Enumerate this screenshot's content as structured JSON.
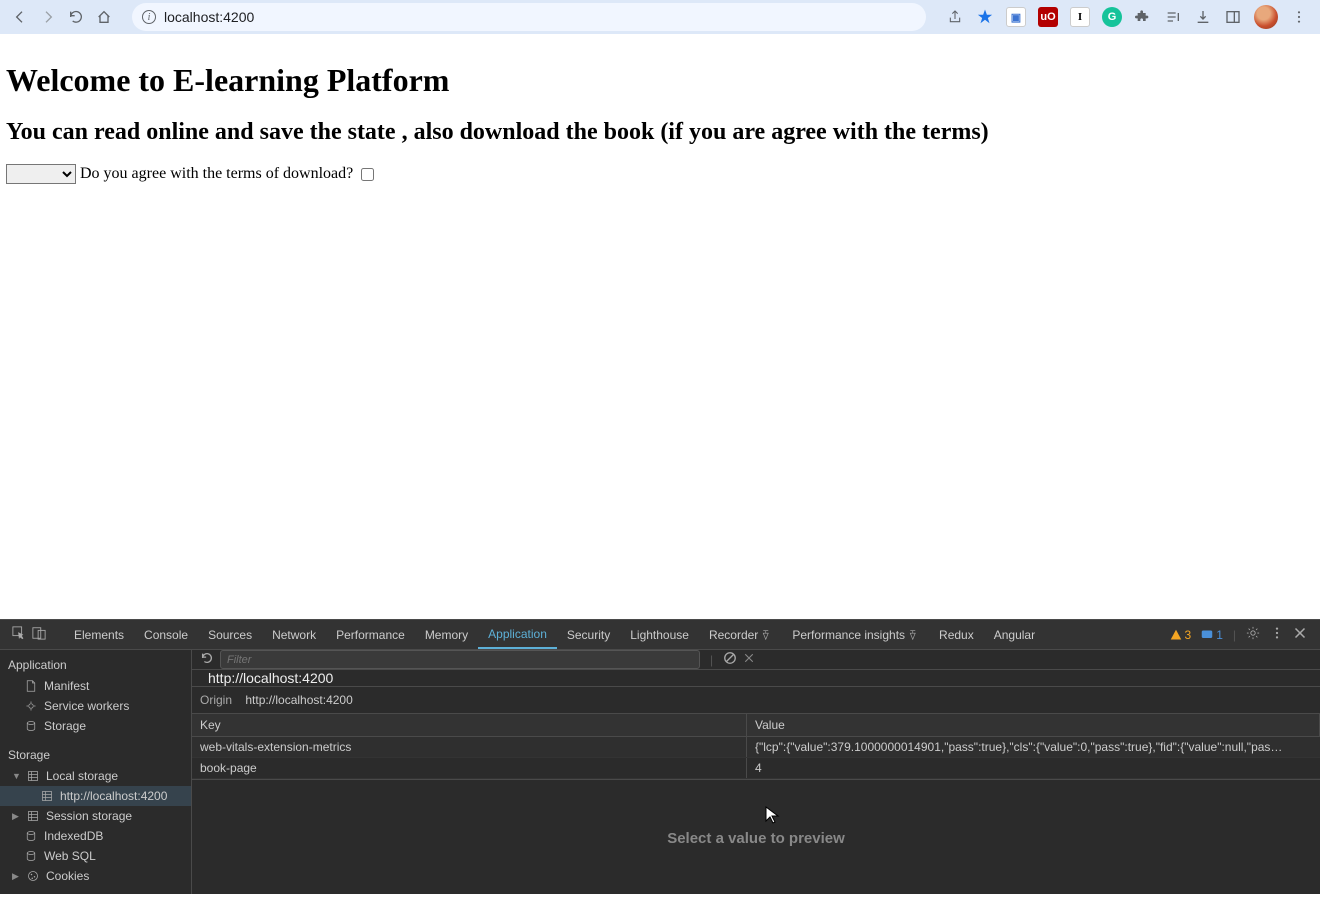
{
  "browser": {
    "url": "localhost:4200",
    "extensions": [
      {
        "bg": "#fff",
        "fg": "#3b73d1",
        "glyph": "▣"
      },
      {
        "bg": "#b30000",
        "fg": "#fff",
        "glyph": "uO"
      },
      {
        "bg": "#fff",
        "fg": "#000",
        "glyph": "I"
      },
      {
        "bg": "#15c39a",
        "fg": "#fff",
        "glyph": "G"
      }
    ]
  },
  "page": {
    "h1": "Welcome to E-learning Platform",
    "h2": "You can read online and save the state , also download the book (if you are agree with the terms)",
    "terms_label": "Do you agree with the terms of download?"
  },
  "devtools": {
    "tabs": [
      "Elements",
      "Console",
      "Sources",
      "Network",
      "Performance",
      "Memory",
      "Application",
      "Security",
      "Lighthouse",
      "Recorder",
      "Performance insights",
      "Redux",
      "Angular"
    ],
    "active_tab": "Application",
    "warn_count": "3",
    "msg_count": "1",
    "filter_placeholder": "Filter",
    "origin_title": "http://localhost:4200",
    "origin_label": "Origin",
    "origin_value": "http://localhost:4200",
    "sidebar": {
      "app_header": "Application",
      "app_items": [
        "Manifest",
        "Service workers",
        "Storage"
      ],
      "storage_header": "Storage",
      "local_storage": "Local storage",
      "local_child": "http://localhost:4200",
      "session_storage": "Session storage",
      "indexeddb": "IndexedDB",
      "websql": "Web SQL",
      "cookies": "Cookies"
    },
    "table": {
      "headers": {
        "key": "Key",
        "value": "Value"
      },
      "rows": [
        {
          "key": "web-vitals-extension-metrics",
          "value": "{\"lcp\":{\"value\":379.1000000014901,\"pass\":true},\"cls\":{\"value\":0,\"pass\":true},\"fid\":{\"value\":null,\"pas…"
        },
        {
          "key": "book-page",
          "value": "4"
        }
      ]
    },
    "preview_text": "Select a value to preview"
  }
}
